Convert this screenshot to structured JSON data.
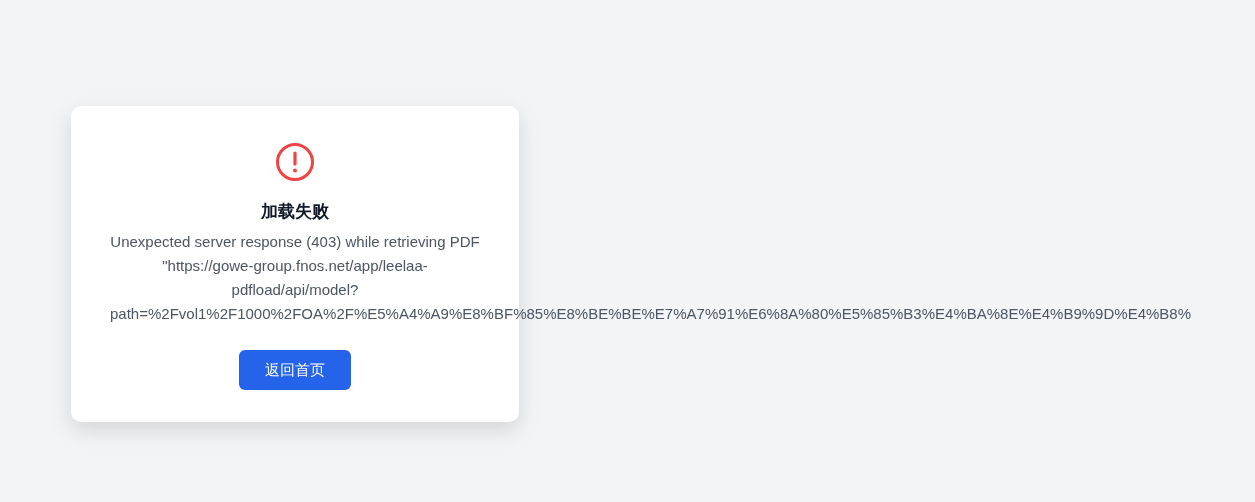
{
  "error_card": {
    "title": "加载失败",
    "message": "Unexpected server response (403) while retrieving PDF \"https://gowe-group.fnos.net/app/leelaa-pdfload/api/model?path=%2Fvol1%2F1000%2FOA%2F%E5%A4%A9%E8%BF%85%E8%BE%BE%E7%A7%91%E6%8A%80%E5%85%B3%E4%BA%8E%E4%B9%9D%E4%B8%",
    "button": "返回首页"
  }
}
